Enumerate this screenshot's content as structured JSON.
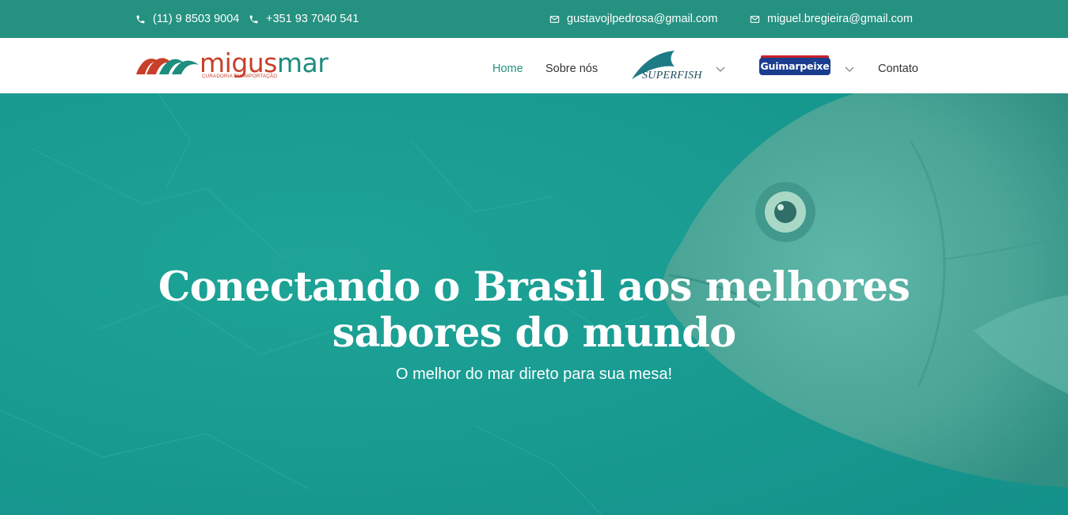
{
  "topbar": {
    "phone1": "(11) 9 8503 9004",
    "phone2": "+351 93 7040 541",
    "email1": "gustavojlpedrosa@gmail.com",
    "email2": "miguel.bregieira@gmail.com",
    "background": "#259181",
    "icons": {
      "phone": "phone-icon",
      "email": "envelope-icon"
    }
  },
  "brand": {
    "name_part1": "migus",
    "name_part2": "mar",
    "tagline": "CURADORIA EM IMPORTAÇÃO",
    "color_red": "#c8402a",
    "color_teal": "#1f8d7e"
  },
  "nav": {
    "home": "Home",
    "about": "Sobre nós",
    "superfish": "SUPERFISH",
    "guimarpeixe": "Guimarpeixe",
    "contact": "Contato",
    "active_color": "#259181",
    "dropdown_icon": "chevron-down-icon"
  },
  "hero": {
    "title_line1": "Conectando o Brasil aos melhores",
    "title_line2": "sabores do mundo",
    "subtitle": "O melhor do mar direto para sua mesa!",
    "overlay_color": "#17988d"
  }
}
